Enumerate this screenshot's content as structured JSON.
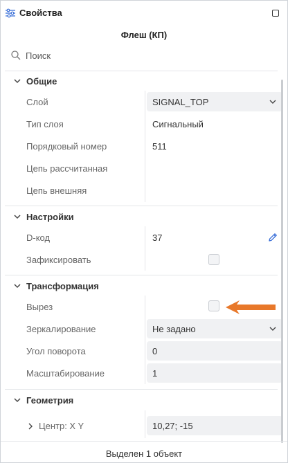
{
  "panel": {
    "title": "Свойства",
    "title_icon": "sliders-icon",
    "maximize_icon": "maximize-icon",
    "subtitle": "Флеш (КП)",
    "search_placeholder": "Поиск"
  },
  "sections": {
    "general": {
      "label": "Общие",
      "layer_label": "Слой",
      "layer_value": "SIGNAL_TOP",
      "layer_type_label": "Тип слоя",
      "layer_type_value": "Сигнальный",
      "order_label": "Порядковый номер",
      "order_value": "511",
      "net_calc_label": "Цепь рассчитанная",
      "net_ext_label": "Цепь внешняя"
    },
    "settings": {
      "label": "Настройки",
      "dcode_label": "D-код",
      "dcode_value": "37",
      "fix_label": "Зафиксировать",
      "fix_checked": false
    },
    "transform": {
      "label": "Трансформация",
      "cutout_label": "Вырез",
      "cutout_checked": false,
      "mirror_label": "Зеркалирование",
      "mirror_value": "Не задано",
      "rotation_label": "Угол поворота",
      "rotation_value": "0",
      "scale_label": "Масштабирование",
      "scale_value": "1"
    },
    "geometry": {
      "label": "Геометрия",
      "center_label": "Центр: X Y",
      "center_value": "10,27; -15"
    }
  },
  "footer": {
    "status": "Выделен 1 объект"
  },
  "colors": {
    "arrow": "#e8782a",
    "pencil": "#3a6fd8",
    "field_bg": "#f0f1f3"
  }
}
